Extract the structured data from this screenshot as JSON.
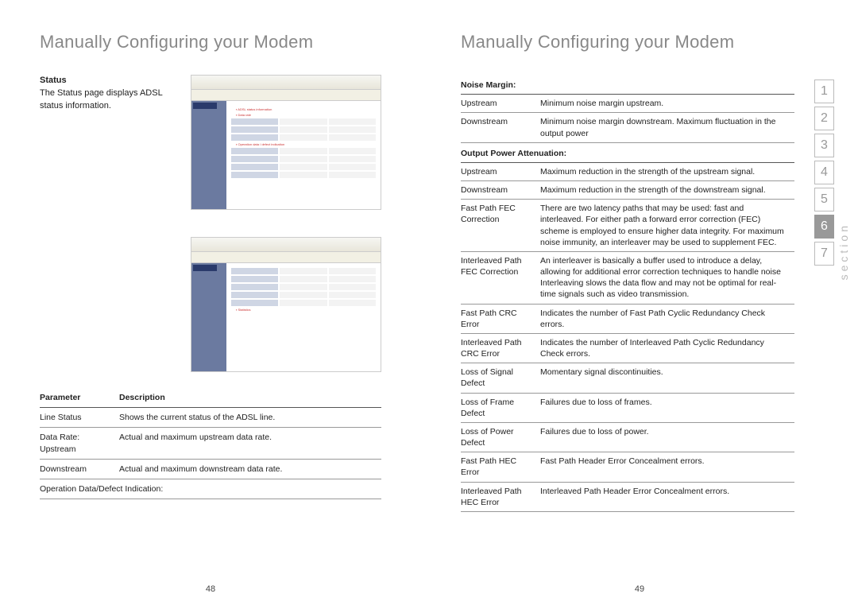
{
  "left": {
    "title": "Manually Configuring your Modem",
    "status_heading": "Status",
    "status_body": "The Status page displays ADSL status information.",
    "table_headers": {
      "param": "Parameter",
      "desc": "Description"
    },
    "rows": [
      {
        "param": "Line Status",
        "desc": "Shows the current status of the ADSL line."
      },
      {
        "param": "Data Rate: Upstream",
        "desc": "Actual and maximum upstream data rate."
      },
      {
        "param": "Downstream",
        "desc": "Actual and maximum downstream data rate."
      },
      {
        "param": "Operation Data/Defect Indication:",
        "desc": ""
      }
    ],
    "page_num": "48"
  },
  "right": {
    "title": "Manually Configuring your Modem",
    "groups": [
      {
        "header": "Noise Margin:",
        "rows": [
          {
            "param": "Upstream",
            "desc": "Minimum noise margin upstream."
          },
          {
            "param": "Downstream",
            "desc": "Minimum noise margin downstream. Maximum fluctuation in the output power"
          }
        ]
      },
      {
        "header": "Output Power Attenuation:",
        "rows": [
          {
            "param": "Upstream",
            "desc": "Maximum reduction in the strength of the upstream signal."
          },
          {
            "param": "Downstream",
            "desc": "Maximum reduction in the strength of the downstream signal."
          },
          {
            "param": "Fast Path FEC Correction",
            "desc": "There are two latency paths that may be used: fast and interleaved. For either path a forward error correction (FEC) scheme is employed to ensure higher data integrity. For maximum noise immunity, an interleaver may be used to supplement FEC."
          },
          {
            "param": "Interleaved Path FEC Correction",
            "desc": "An interleaver is basically a buffer used to introduce a delay, allowing for additional error correction techniques to handle noise Interleaving slows the data flow and may not be optimal for real-time signals such as video transmission."
          },
          {
            "param": "Fast Path CRC Error",
            "desc": "Indicates the number of Fast Path Cyclic Redundancy Check errors."
          },
          {
            "param": "Interleaved Path CRC Error",
            "desc": "Indicates the number of Interleaved Path Cyclic Redundancy Check errors."
          },
          {
            "param": "Loss of Signal Defect",
            "desc": "Momentary signal discontinuities."
          },
          {
            "param": "Loss of Frame Defect",
            "desc": "Failures due to loss of frames."
          },
          {
            "param": "Loss of Power Defect",
            "desc": "Failures due to loss of power."
          },
          {
            "param": "Fast Path HEC Error",
            "desc": "Fast Path Header Error Concealment errors."
          },
          {
            "param": "Interleaved Path HEC Error",
            "desc": "Interleaved Path Header Error Concealment errors."
          }
        ]
      }
    ],
    "page_num": "49",
    "section_label": "section",
    "tabs": [
      "1",
      "2",
      "3",
      "4",
      "5",
      "6",
      "7"
    ],
    "active_tab": "6"
  }
}
